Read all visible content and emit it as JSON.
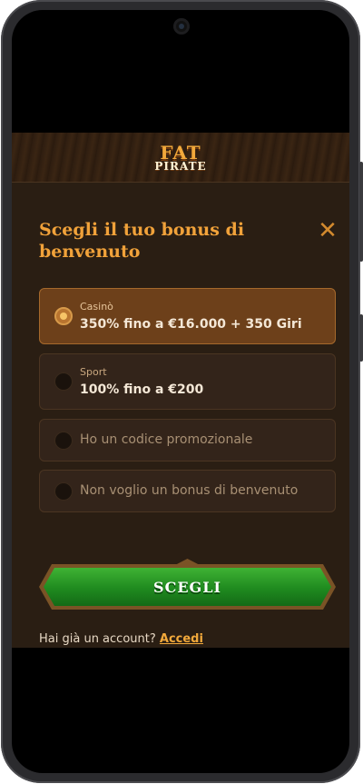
{
  "brand": {
    "logo_line1": "FAT",
    "logo_line2": "PIRATE"
  },
  "modal": {
    "title": "Scegli il tuo bonus di benvenuto",
    "close_icon": "close-icon",
    "options": [
      {
        "category": "Casinò",
        "label": "350% fino a €16.000 + 350 Giri",
        "selected": true
      },
      {
        "category": "Sport",
        "label": "100% fino a €200",
        "selected": false
      },
      {
        "label": "Ho un codice promozionale",
        "selected": false
      },
      {
        "label": "Non voglio un bonus di benvenuto",
        "selected": false
      }
    ],
    "cta_label": "SCEGLI",
    "login_prompt": "Hai già un account?",
    "login_link": "Accedi"
  },
  "colors": {
    "accent": "#f1a23a",
    "panel_bg": "#2a1e13",
    "selected_bg": "#6d401a",
    "cta_green": "#1f8a1f"
  }
}
